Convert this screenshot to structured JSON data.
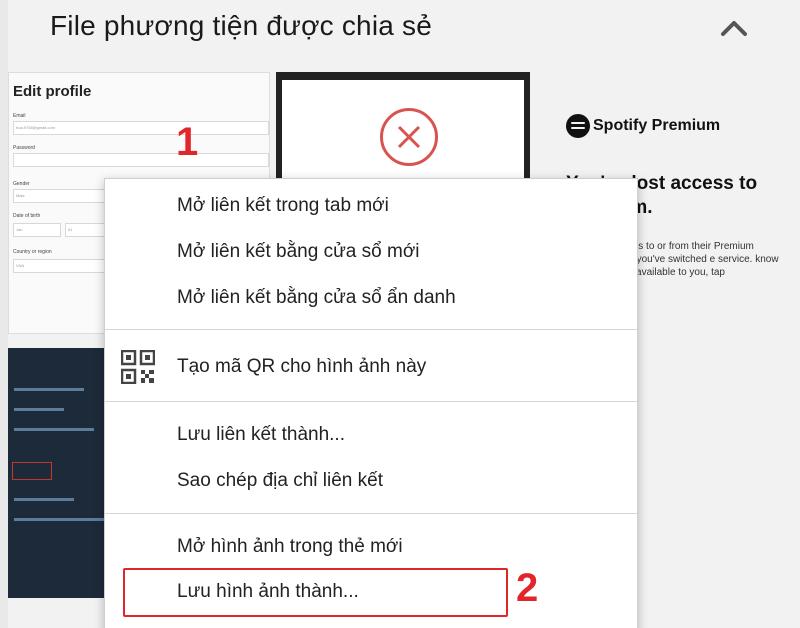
{
  "panel": {
    "title": "File phương tiện được chia sẻ"
  },
  "thumbnails": {
    "edit_profile": {
      "title": "Edit profile",
      "fields": [
        "Email",
        "Password",
        "Gender",
        "Date of birth",
        "Country or region"
      ],
      "values": [
        "hoa.9758@gmail.com",
        "Male",
        "Jan",
        "01",
        "VNA"
      ]
    },
    "spotify": {
      "logo_text": "Spotify Premium",
      "heading": "You've lost access to Premium.",
      "body": "either lost access to or from their Premium Family ons that you've switched e service. know more about the available to you, tap"
    }
  },
  "context_menu": {
    "items": [
      "Mở liên kết trong tab mới",
      "Mở liên kết bằng cửa sổ mới",
      "Mở liên kết bằng cửa sổ ẩn danh",
      "Tạo mã QR cho hình ảnh này",
      "Lưu liên kết thành...",
      "Sao chép địa chỉ liên kết",
      "Mở hình ảnh trong thẻ mới",
      "Lưu hình ảnh thành..."
    ]
  },
  "annotations": {
    "step1": "1",
    "step2": "2"
  },
  "colors": {
    "annotation_red": "#e0262a",
    "menu_bg": "#ffffff",
    "panel_bg": "#f2f2f2"
  },
  "icons": {
    "collapse": "chevron-up-icon",
    "qr": "qr-code-icon",
    "close": "close-x-icon",
    "spotify": "spotify-logo-icon"
  }
}
